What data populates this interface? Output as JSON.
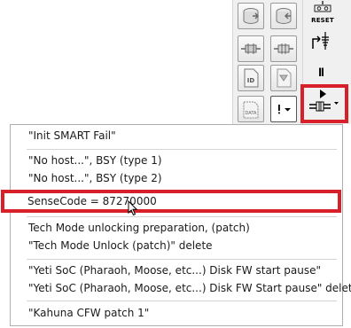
{
  "toolbar": {
    "reset_label": "RESET",
    "pause_symbol": "II",
    "icons": [
      "disk-out-icon",
      "disk-in-icon",
      "resistor-icon",
      "resistor-alt-icon",
      "id-page-icon",
      "filter-page-icon",
      "data-page-icon",
      "command-menu-icon",
      "reset-icon",
      "probe-icon",
      "pause-icon",
      "script-run-icon"
    ]
  },
  "colors": {
    "highlight": "#d8202a",
    "menu_border": "#aeaeae",
    "toolbar_bg": "#f0f0f0"
  },
  "menu": {
    "items": [
      {
        "label": "\"Init SMART Fail\""
      },
      {
        "label": "\"No host...\", BSY (type 1)"
      },
      {
        "label": "\"No host...\", BSY (type 2)"
      },
      {
        "label": "SenseCode = 87270000"
      },
      {
        "label": "Tech Mode unlocking preparation, (patch)"
      },
      {
        "label": "\"Tech Mode Unlock (patch)\" delete"
      },
      {
        "label": "\"Yeti SoC (Pharaoh, Moose, etc...) Disk FW start pause\""
      },
      {
        "label": "\"Yeti SoC (Pharaoh, Moose, etc...) Disk FW Start pause\" delete"
      },
      {
        "label": "\"Kahuna CFW patch 1\""
      }
    ]
  }
}
